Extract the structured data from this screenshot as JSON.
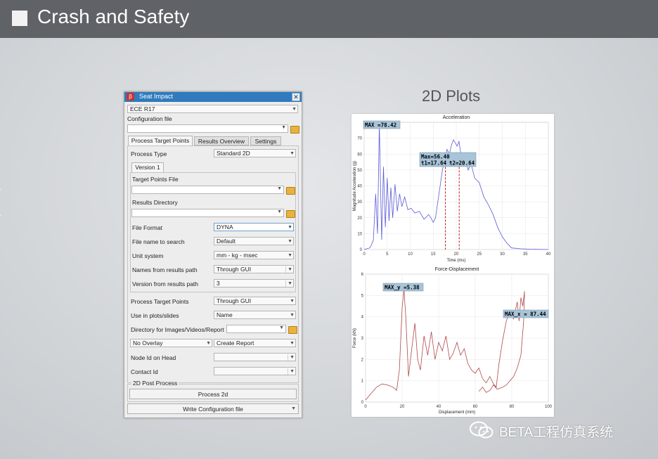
{
  "slide": {
    "title": "Crash and Safety",
    "plots_heading": "2D Plots"
  },
  "dialog": {
    "title": "Seat Impact",
    "close_label": "✕",
    "standard": "ECE R17",
    "config_file_label": "Configuration file",
    "tabs": [
      "Process Target Points",
      "Results Overview",
      "Settings"
    ],
    "process_type_label": "Process Type",
    "process_type_value": "Standard 2D",
    "version_tab": "Version 1",
    "target_points_file_label": "Target Points File",
    "results_directory_label": "Results Directory",
    "fields": [
      {
        "label": "File Format",
        "value": "DYNA"
      },
      {
        "label": "File name to search",
        "value": "Default"
      },
      {
        "label": "Unit system",
        "value": "mm - kg - msec"
      },
      {
        "label": "Names from results path",
        "value": "Through GUI"
      },
      {
        "label": "Version from results path",
        "value": "3"
      }
    ],
    "process_target_points_label": "Process Target Points",
    "process_target_points_value": "Through GUI",
    "use_in_plots_label": "Use in plots/slides",
    "use_in_plots_value": "Name",
    "directory_label": "Directory for Images/Videos/Report",
    "overlay_value": "No Overlay",
    "report_value": "Create Report",
    "node_id_label": "Node Id on Head",
    "contact_id_label": "Contact Id",
    "post_group_label": "2D Post Process",
    "process_button": "Process 2d",
    "write_button": "Write Configuration file"
  },
  "chart_data": [
    {
      "type": "line",
      "title": "Acceleration",
      "xlabel": "Time (ms)",
      "ylabel": "Magnitude Acceleration (g)",
      "xlim": [
        0,
        40
      ],
      "ylim": [
        0,
        80
      ],
      "xticks": [
        0,
        5,
        10,
        15,
        20,
        25,
        30,
        35,
        40
      ],
      "yticks": [
        0,
        10,
        20,
        30,
        40,
        50,
        60,
        70
      ],
      "grid": true,
      "color": "#5a5ad8",
      "x": [
        0,
        1.2,
        1.6,
        2.0,
        2.5,
        2.9,
        3.3,
        3.8,
        4.2,
        4.6,
        5.0,
        5.4,
        5.8,
        6.2,
        6.7,
        7.2,
        7.7,
        8.2,
        8.8,
        9.5,
        10.2,
        11,
        12,
        13,
        14,
        14.5,
        15,
        15.5,
        16,
        16.5,
        17,
        17.5,
        18,
        18.5,
        19,
        19.4,
        19.8,
        20.2,
        20.6,
        21,
        21.5,
        22,
        22.6,
        23.2,
        24,
        25,
        26,
        27,
        28,
        29,
        30,
        31,
        32,
        34,
        36,
        40
      ],
      "y": [
        0,
        1,
        3,
        6,
        35,
        10,
        78.4,
        6,
        52,
        14,
        45,
        18,
        39,
        20,
        41,
        24,
        35,
        27,
        33,
        25,
        26,
        23,
        24,
        19,
        22,
        20,
        17,
        20,
        30,
        40,
        50,
        57,
        63,
        60,
        66,
        69,
        67,
        65,
        68,
        60,
        55,
        57,
        50,
        54,
        45,
        42,
        33,
        28,
        22,
        14,
        8,
        4,
        1,
        0.5,
        0.2,
        0
      ],
      "annotations": [
        "MAX =78.42",
        "Max=56.40",
        "t1=17.64",
        "t2=20.64"
      ],
      "markers_x": [
        17.64,
        20.64
      ],
      "marker_color": "#c0141e"
    },
    {
      "type": "line",
      "title": "Force-Displacement",
      "xlabel": "Displacement (mm)",
      "ylabel": "Force (kN)",
      "xlim": [
        0,
        100
      ],
      "ylim": [
        0,
        6
      ],
      "xticks": [
        0,
        20,
        40,
        60,
        80,
        100
      ],
      "yticks": [
        0,
        1,
        2,
        3,
        4,
        5,
        6
      ],
      "grid": true,
      "color": "#b04848",
      "x": [
        0,
        3,
        6,
        9,
        12,
        15,
        17,
        18.5,
        20,
        21,
        22,
        23.5,
        25,
        27,
        28.5,
        30,
        32,
        34,
        36,
        38,
        40,
        42,
        44,
        46,
        48,
        50,
        52,
        54,
        56,
        58,
        60,
        62,
        64,
        66,
        68,
        70,
        71.5,
        73,
        75,
        77,
        79,
        81,
        83,
        84,
        85,
        86,
        87,
        86.5,
        85,
        83,
        81,
        79,
        77,
        75,
        72,
        70,
        68,
        66,
        64,
        62
      ],
      "y": [
        0.1,
        0.4,
        0.7,
        0.85,
        0.8,
        0.7,
        0.55,
        1.5,
        4.4,
        5.3,
        4.0,
        1.2,
        2.3,
        3.7,
        2.0,
        1.5,
        3.1,
        2.2,
        3.3,
        2.0,
        2.8,
        2.4,
        3.1,
        2.0,
        2.3,
        2.8,
        2.2,
        2.5,
        1.8,
        1.5,
        1.35,
        1.6,
        1.1,
        0.9,
        1.2,
        0.85,
        0.7,
        1.8,
        2.9,
        3.8,
        4.3,
        3.9,
        4.7,
        3.8,
        4.9,
        4.5,
        5.2,
        3.8,
        2.2,
        1.6,
        1.2,
        1.0,
        0.8,
        0.7,
        0.6,
        0.8,
        0.55,
        0.45,
        0.7,
        0.5
      ],
      "annotations": [
        "MAX_y =5.38",
        "MAX_x = 87.44"
      ]
    }
  ],
  "watermark": {
    "text": "BETA工程仿真系统",
    "icon": "wechat-icon"
  }
}
